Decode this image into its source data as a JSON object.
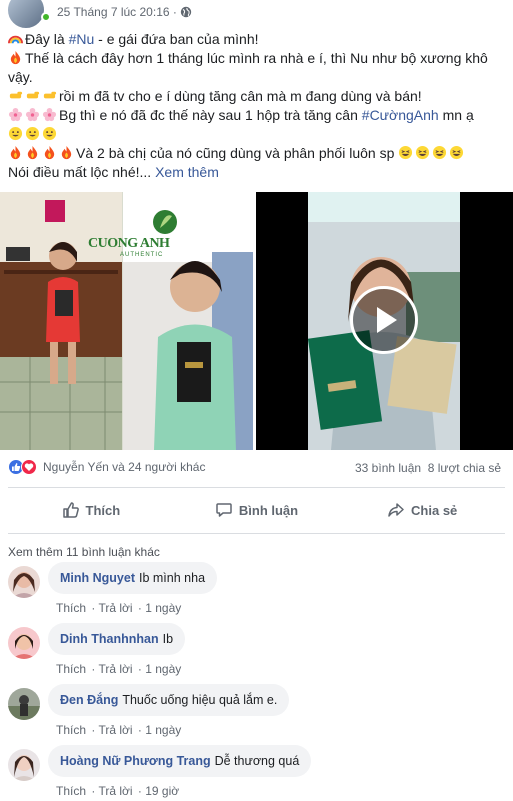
{
  "post": {
    "timestamp": "25 Tháng 7 lúc 20:16 · ",
    "lines": [
      {
        "prefix": "Đây là ",
        "hashtag": "#Nu",
        "suffix": " - e gái đứa ban của mình!"
      },
      {
        "text": "Thế là cách đây hơn 1 tháng lúc mình ra nhà e í, thì Nu như bộ xương khô"
      },
      {
        "text": "vậy."
      },
      {
        "text": "rồi m đã tv cho e í dùng tăng cân mà m đang dùng và bán!"
      },
      {
        "prefix": "Bg thì e nó đã đc thế này sau 1 hộp trà tăng cân ",
        "hashtag": "#CườngAnh",
        "suffix": " mn ạ"
      },
      {
        "text": "Và 2 bà chị của nó cũng dùng và phân phối luôn sp"
      },
      {
        "text": "Nói điều mất lộc nhé!... ",
        "see_more": "Xem thêm"
      }
    ]
  },
  "media": {
    "brand_name": "CUONG ANH",
    "brand_sub": "AUTHENTIC"
  },
  "stats": {
    "reactors": "Nguyễn Yến và 24 người khác",
    "comments": "33 bình luận",
    "shares": "8 lượt chia sẻ"
  },
  "actions": {
    "like": "Thích",
    "comment": "Bình luận",
    "share": "Chia sẻ"
  },
  "more_comments": "Xem thêm 11 bình luận khác",
  "comments": [
    {
      "name": "Minh Nguyet",
      "text": "Ib mình nha",
      "like": "Thích",
      "reply": "Trả lời",
      "time": "1 ngày"
    },
    {
      "name": "Dinh Thanhnhan",
      "text": "Ib",
      "like": "Thích",
      "reply": "Trả lời",
      "time": "1 ngày"
    },
    {
      "name": "Đen Đắng",
      "text": "Thuốc uống hiệu quả lắm e.",
      "like": "Thích",
      "reply": "Trả lời",
      "time": "1 ngày"
    },
    {
      "name": "Hoàng Nữ Phương Trang",
      "text": "Dễ thương quá",
      "like": "Thích",
      "reply": "Trả lời",
      "time": "19 giờ"
    }
  ],
  "colors": {
    "link": "#385898",
    "like_blue": "#3b6fe2",
    "love_red": "#f0284a",
    "meta_gray": "#606770"
  },
  "icons": [
    "globe-icon",
    "rainbow-icon",
    "fire-icon",
    "pointing-hand-icon",
    "cherry-blossom-icon",
    "grinning-icon",
    "laughing-icon",
    "like-reaction-icon",
    "love-reaction-icon",
    "thumbs-up-icon",
    "comment-icon",
    "share-icon",
    "play-icon"
  ]
}
